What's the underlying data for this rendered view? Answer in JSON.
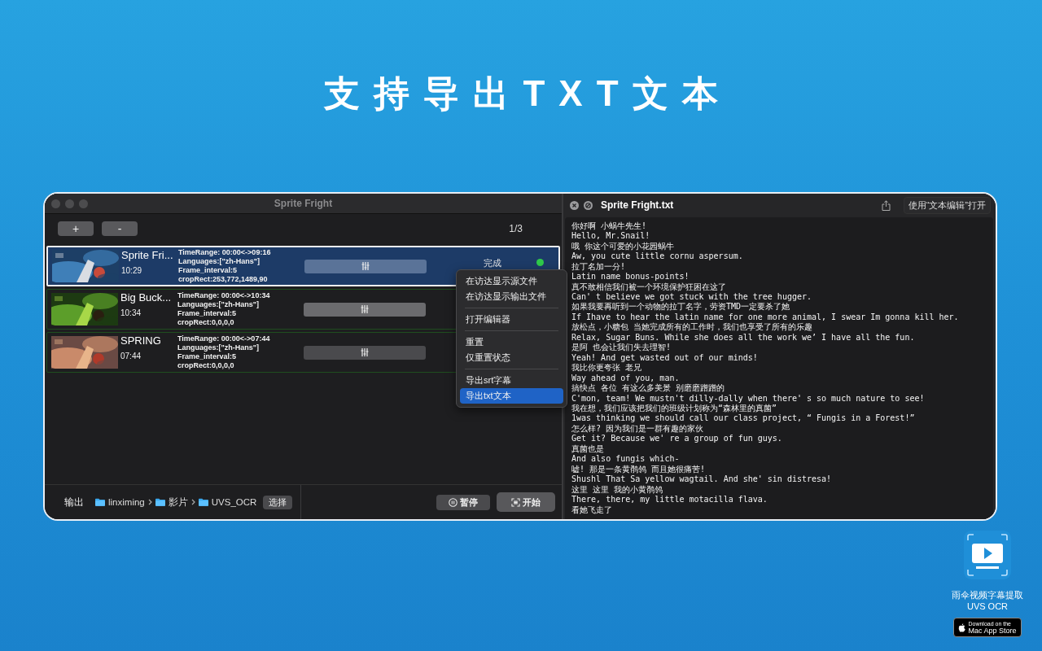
{
  "headline": "支持导出TXT文本",
  "app_window": {
    "title": "Sprite Fright",
    "toolbar_buttons": [
      "+",
      "-"
    ],
    "page_counter": "1/3",
    "jobs": [
      {
        "name": "Sprite Fri...",
        "duration": "10:29",
        "info": [
          "TimeRange: 00:00<->09:16",
          "Languages:[\"zh-Hans\"]",
          "Frame_interval:5",
          "cropRect:253,772,1489,90"
        ],
        "status": "完成",
        "completed": true,
        "selected": true
      },
      {
        "name": "Big Buck...",
        "duration": "10:34",
        "info": [
          "TimeRange: 00:00<->10:34",
          "Languages:[\"zh-Hans\"]",
          "Frame_interval:5",
          "cropRect:0,0,0,0"
        ],
        "selected": false
      },
      {
        "name": "SPRING",
        "duration": "07:44",
        "info": [
          "TimeRange: 00:00<->07:44",
          "Languages:[\"zh-Hans\"]",
          "Frame_interval:5",
          "cropRect:0,0,0,0"
        ],
        "selected": false
      }
    ],
    "output": {
      "label": "输出",
      "path": [
        "linximing",
        "影片",
        "UVS_OCR"
      ],
      "choose_button": "选择",
      "pause_button": "暂停",
      "start_button": "开始"
    }
  },
  "context_menu": {
    "groups": [
      [
        {
          "label": "在访达显示源文件",
          "selected": false
        },
        {
          "label": "在访达显示输出文件",
          "selected": false
        }
      ],
      [
        {
          "label": "打开编辑器",
          "selected": false
        }
      ],
      [
        {
          "label": "重置",
          "selected": false
        },
        {
          "label": "仅重置状态",
          "selected": false
        }
      ],
      [
        {
          "label": "导出srt字幕",
          "selected": false
        },
        {
          "label": "导出txt文本",
          "selected": true
        }
      ]
    ]
  },
  "preview": {
    "title": "Sprite Fright.txt",
    "open_with_button": "使用“文本编辑”打开",
    "lines": [
      "你好啊 小蜗牛先生!",
      "Hello, Mr.Snail!",
      "哦 你这个可爱的小花园蜗牛",
      "Aw, you cute little cornu aspersum.",
      "拉丁名加一分!",
      "Latin name bonus-points!",
      "真不敢相信我们被一个环境保护狂困在这了",
      "Can' t believe we got stuck with the tree hugger.",
      "如果我要再听到一个动物的拉丁名字，劳资TMD一定要杀了她",
      "If Ihave to hear the latin name for one more animal, I swear Im gonna kill her.",
      "放松点，小糖包 当她完成所有的工作时，我们也享受了所有的乐趣",
      "Relax, Sugar Buns. While she does all the work we’ I have all the fun.",
      "是阿 也会让我们失去理智!",
      "Yeah! And get wasted out of our minds!",
      "我比你更夸张 老兄",
      "Way ahead of you, man.",
      "搞快点 各位 有这么多美景 别磨磨蹭蹭的",
      "C'mon, team! We mustn't dilly-dally when there' s so much nature to see!",
      "我在想，我们应该把我们的班级计划称为“森林里的真菌”",
      "1was thinking we should call our class project, “ Fungis in a Forest!”",
      "怎么样? 因为我们是一群有趣的家伙",
      "Get it? Because we' re a group of fun guys.",
      "真菌也是",
      "And also fungis which-",
      "嘘! 那是一条黄鹡鸰 而且她很痛苦!",
      "Shushl That Sa yellow wagtail. And she' sin distresa!",
      "这里 这里 我的小黄鹡鸰",
      "There, there, my little motacilla flava.",
      "看她飞走了"
    ]
  },
  "app_badge": {
    "name": "雨伞视频字幕提取",
    "subtitle": "UVS OCR",
    "store_badge": {
      "small_text": "Download on the",
      "large_text": "Mac App Store"
    }
  }
}
